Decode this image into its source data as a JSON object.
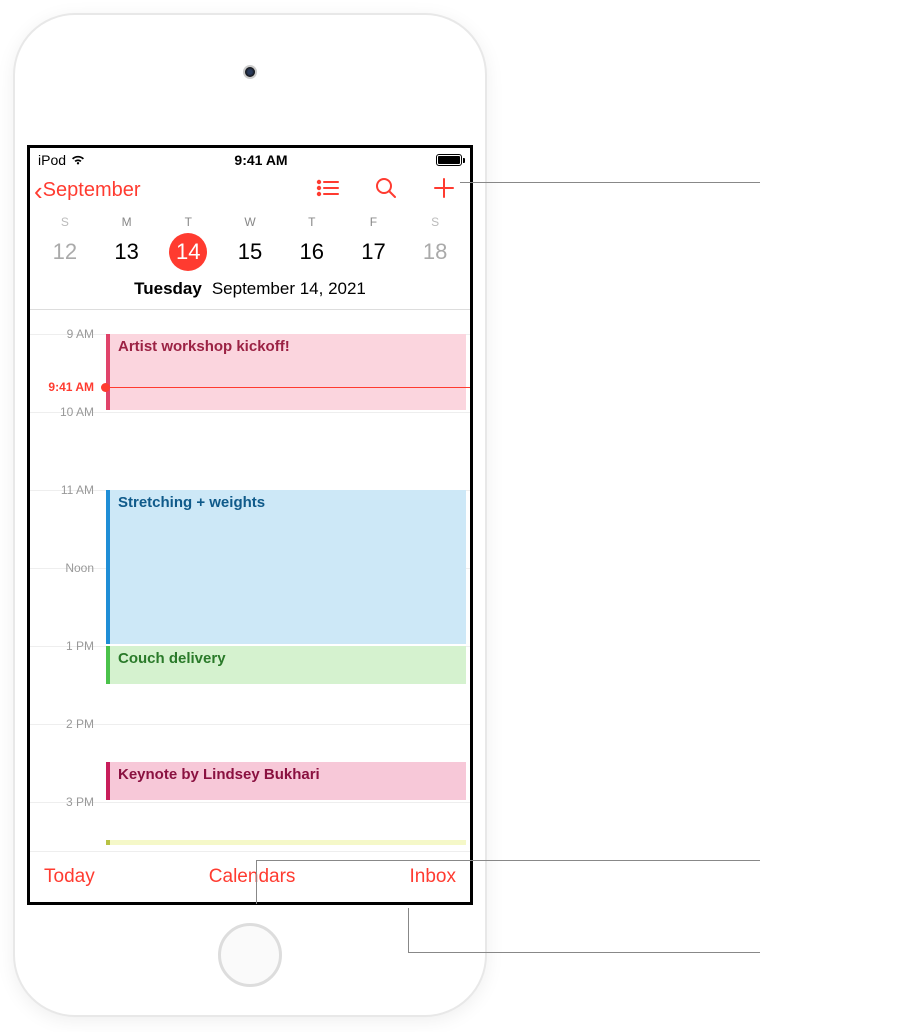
{
  "statusBar": {
    "carrier": "iPod",
    "time": "9:41 AM"
  },
  "nav": {
    "back": "September"
  },
  "week": {
    "dowLabels": [
      "S",
      "M",
      "T",
      "W",
      "T",
      "F",
      "S"
    ],
    "dates": [
      "12",
      "13",
      "14",
      "15",
      "16",
      "17",
      "18"
    ],
    "selectedIndex": 2
  },
  "currentDate": {
    "dayName": "Tuesday",
    "full": "September 14, 2021"
  },
  "timeline": {
    "hours": [
      "9 AM",
      "10 AM",
      "11 AM",
      "Noon",
      "1 PM",
      "2 PM",
      "3 PM"
    ],
    "nowLabel": "9:41 AM"
  },
  "events": {
    "e0": "Artist workshop kickoff!",
    "e1": "Stretching + weights",
    "e2": "Couch delivery",
    "e3": "Keynote by Lindsey Bukhari"
  },
  "toolbar": {
    "today": "Today",
    "calendars": "Calendars",
    "inbox": "Inbox"
  }
}
